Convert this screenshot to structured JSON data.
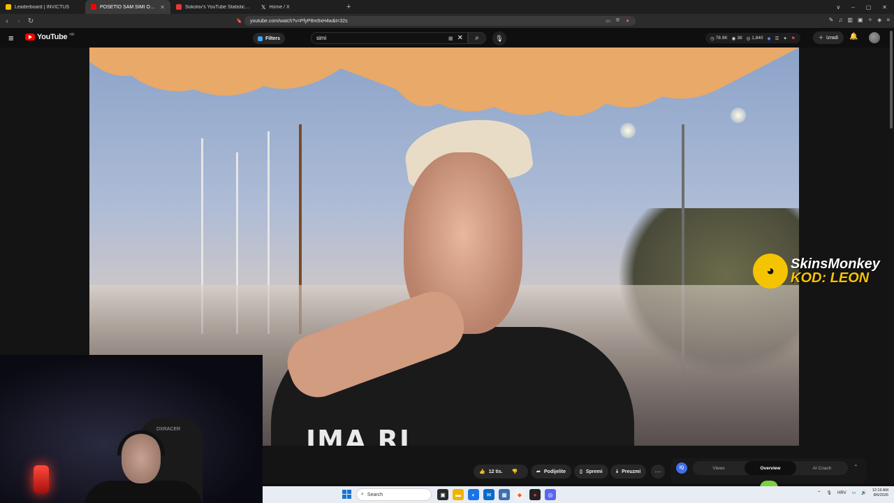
{
  "browser": {
    "tabs": [
      {
        "label": "Leaderboard | INVICTUS",
        "favicon_color": "#f2c200",
        "active": false
      },
      {
        "label": "POSETIO SAM SIMI OSTRVO NA",
        "favicon_color": "#ff0000",
        "active": true
      },
      {
        "label": "Sokolov's YouTube Statistics - Social",
        "favicon_color": "#e53935",
        "active": false
      },
      {
        "label": "Home / X",
        "favicon_color": "#ffffff",
        "active": false
      }
    ],
    "new_tab_symbol": "+",
    "url": "youtube.com/watch?v=PfyP8m9xH4w&t=32s",
    "window_controls": [
      "∨",
      "–",
      "▢",
      "✕"
    ]
  },
  "youtube": {
    "logo_text": "YouTube",
    "region": "HR",
    "filters_label": "Filters",
    "search_value": "simi",
    "stats": {
      "views": "78.9K",
      "viewers": "38",
      "likes": "1,840"
    },
    "create_label": "Izradi"
  },
  "video": {
    "shirt_text": "IMA RI",
    "sponsor_brand": "SkinsMonkey",
    "sponsor_code": "KOD: LEON"
  },
  "webcam": {
    "chair_brand": "DXRACER"
  },
  "actions": {
    "like_count": "12 tis.",
    "share_label": "Podijelite",
    "save_label": "Spremi",
    "download_label": "Preuzmi"
  },
  "iq_panel": {
    "logo": "IQ",
    "tabs": [
      "Views",
      "Overview",
      "AI Coach"
    ],
    "active_tab": "Overview"
  },
  "taskbar": {
    "search_placeholder": "Search",
    "language": "HRV",
    "time": "12:19 AM",
    "date": "8/6/2026"
  },
  "colors": {
    "brand_red": "#ff0000",
    "accent_blue": "#3ea6ff",
    "sponsor_yellow": "#f5c400"
  }
}
